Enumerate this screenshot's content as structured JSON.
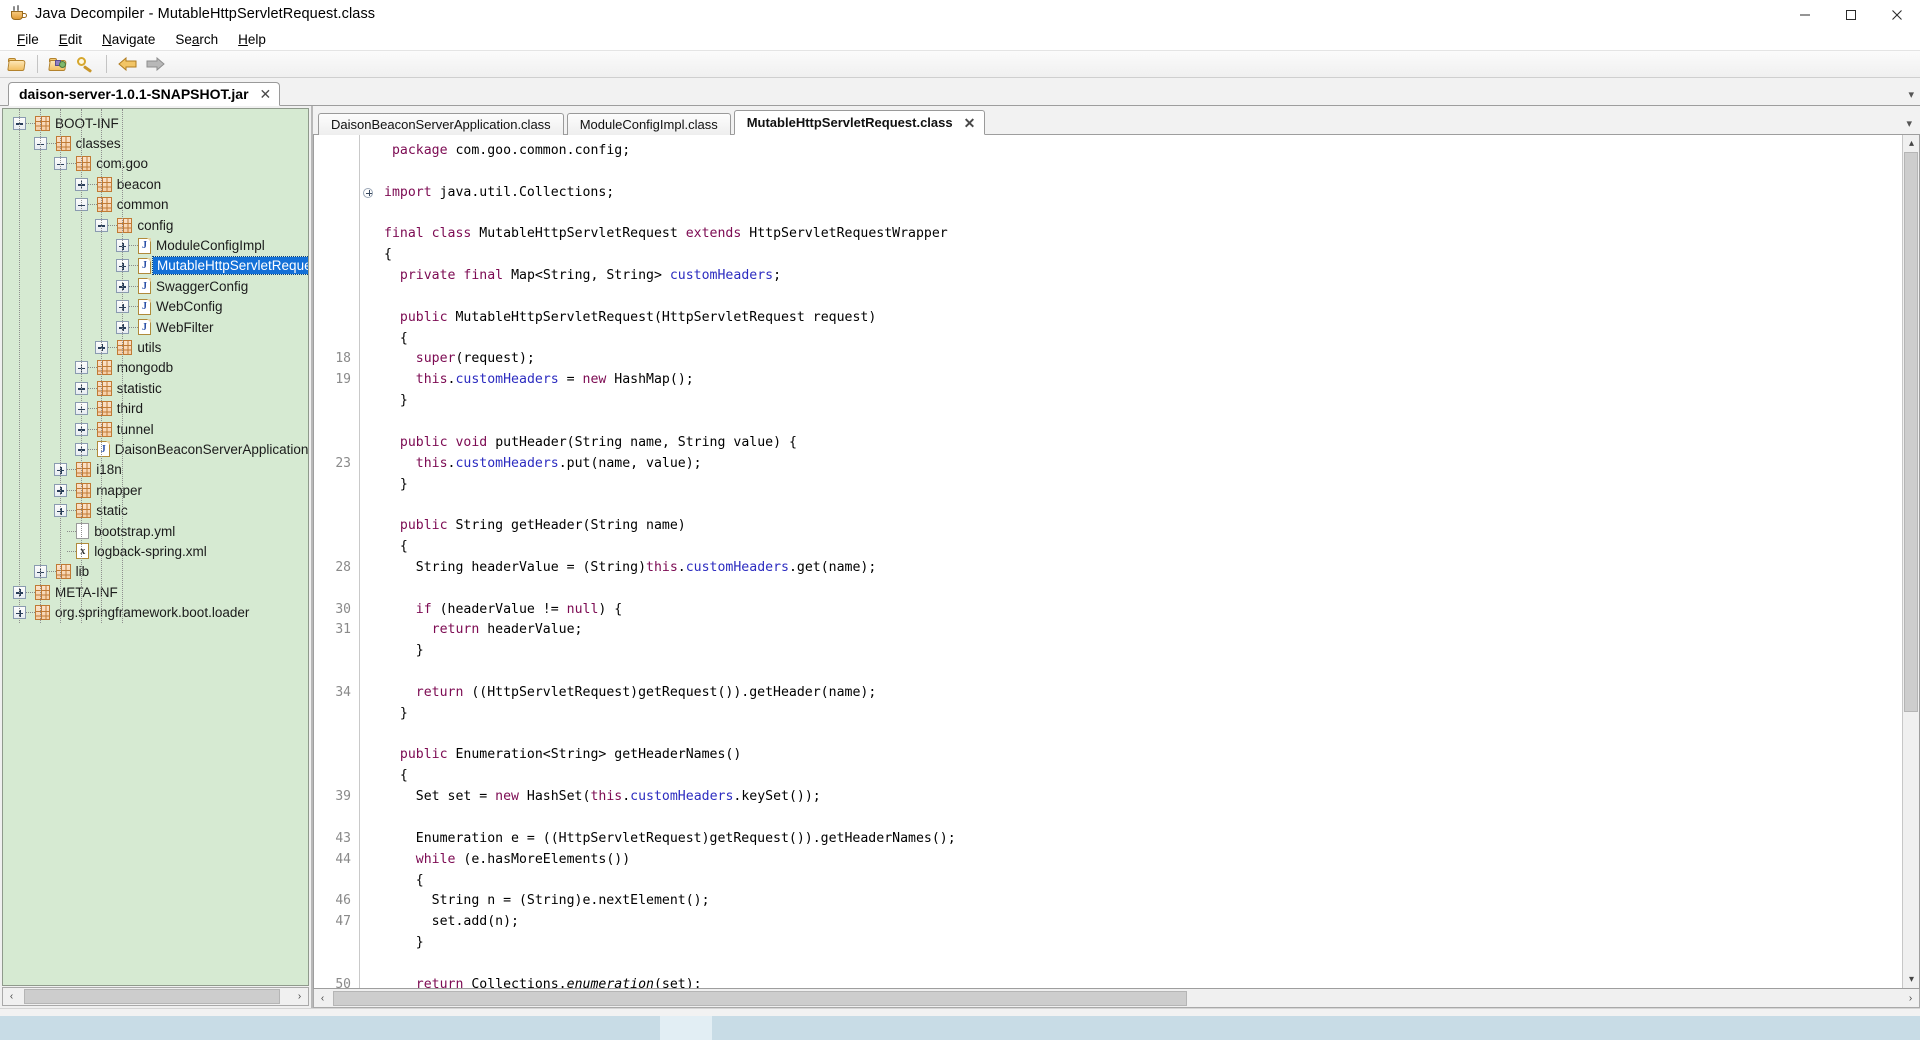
{
  "window": {
    "title": "Java Decompiler - MutableHttpServletRequest.class",
    "app_icon": "java-cup-icon",
    "minimize_label": "─",
    "maximize_label": "❐",
    "close_label": "✕"
  },
  "menubar": {
    "items": [
      {
        "label": "File",
        "mnemonic": "F"
      },
      {
        "label": "Edit",
        "mnemonic": "E"
      },
      {
        "label": "Navigate",
        "mnemonic": "N"
      },
      {
        "label": "Search",
        "mnemonic": "a"
      },
      {
        "label": "Help",
        "mnemonic": "H"
      }
    ]
  },
  "toolbar": {
    "buttons": [
      {
        "name": "open-file-button",
        "icon": "open-folder-icon",
        "tooltip": "Open File"
      },
      {
        "name": "open-type-button",
        "icon": "package-folder-icon",
        "tooltip": "Open Type"
      },
      {
        "name": "search-button",
        "icon": "magnifier-key-icon",
        "tooltip": "Search"
      },
      {
        "name": "back-button",
        "icon": "arrow-left-icon",
        "tooltip": "Back"
      },
      {
        "name": "forward-button",
        "icon": "arrow-right-icon",
        "tooltip": "Forward"
      }
    ]
  },
  "jar_tabs": {
    "active": "daison-server-1.0.1-SNAPSHOT.jar",
    "close_label": "✕",
    "overflow_label": "▾"
  },
  "tree": {
    "background_color": "#d6ead2",
    "selection_color": "#1370d7",
    "nodes": [
      {
        "label": "BOOT-INF",
        "depth": 0,
        "toggle": "minus",
        "icon": "package-icon",
        "selected": false
      },
      {
        "label": "classes",
        "depth": 1,
        "toggle": "minus",
        "icon": "package-icon",
        "selected": false
      },
      {
        "label": "com.goo",
        "depth": 2,
        "toggle": "minus",
        "icon": "package-icon",
        "selected": false
      },
      {
        "label": "beacon",
        "depth": 3,
        "toggle": "plus",
        "icon": "package-icon",
        "selected": false
      },
      {
        "label": "common",
        "depth": 3,
        "toggle": "minus",
        "icon": "package-icon",
        "selected": false
      },
      {
        "label": "config",
        "depth": 4,
        "toggle": "minus",
        "icon": "package-icon",
        "selected": false
      },
      {
        "label": "ModuleConfigImpl",
        "depth": 5,
        "toggle": "plus",
        "icon": "class-icon",
        "selected": false
      },
      {
        "label": "MutableHttpServletRequest",
        "depth": 5,
        "toggle": "plus",
        "icon": "class-icon",
        "selected": true
      },
      {
        "label": "SwaggerConfig",
        "depth": 5,
        "toggle": "plus",
        "icon": "class-icon",
        "selected": false
      },
      {
        "label": "WebConfig",
        "depth": 5,
        "toggle": "plus",
        "icon": "class-icon",
        "selected": false
      },
      {
        "label": "WebFilter",
        "depth": 5,
        "toggle": "plus",
        "icon": "class-icon",
        "selected": false
      },
      {
        "label": "utils",
        "depth": 4,
        "toggle": "plus",
        "icon": "package-icon",
        "selected": false
      },
      {
        "label": "mongodb",
        "depth": 3,
        "toggle": "plus",
        "icon": "package-icon",
        "selected": false
      },
      {
        "label": "statistic",
        "depth": 3,
        "toggle": "plus",
        "icon": "package-icon",
        "selected": false
      },
      {
        "label": "third",
        "depth": 3,
        "toggle": "plus",
        "icon": "package-icon",
        "selected": false
      },
      {
        "label": "tunnel",
        "depth": 3,
        "toggle": "plus",
        "icon": "package-icon",
        "selected": false
      },
      {
        "label": "DaisonBeaconServerApplication",
        "depth": 3,
        "toggle": "plus",
        "icon": "class-icon",
        "selected": false
      },
      {
        "label": "i18n",
        "depth": 2,
        "toggle": "plus",
        "icon": "package-icon",
        "selected": false
      },
      {
        "label": "mapper",
        "depth": 2,
        "toggle": "plus",
        "icon": "package-icon",
        "selected": false
      },
      {
        "label": "static",
        "depth": 2,
        "toggle": "plus",
        "icon": "package-icon",
        "selected": false
      },
      {
        "label": "bootstrap.yml",
        "depth": 2,
        "toggle": "none",
        "icon": "file-icon",
        "selected": false
      },
      {
        "label": "logback-spring.xml",
        "depth": 2,
        "toggle": "none",
        "icon": "xml-file-icon",
        "selected": false
      },
      {
        "label": "lib",
        "depth": 1,
        "toggle": "plus",
        "icon": "package-icon",
        "selected": false
      },
      {
        "label": "META-INF",
        "depth": 0,
        "toggle": "plus",
        "icon": "package-icon",
        "selected": false
      },
      {
        "label": "org.springframework.boot.loader",
        "depth": 0,
        "toggle": "plus",
        "icon": "package-icon",
        "selected": false
      }
    ]
  },
  "editor": {
    "tabs": [
      {
        "label": "DaisonBeaconServerApplication.class",
        "active": false
      },
      {
        "label": "ModuleConfigImpl.class",
        "active": false
      },
      {
        "label": "MutableHttpServletRequest.class",
        "active": true
      }
    ],
    "close_label": "✕",
    "overflow_label": "▾",
    "fold_marker": "+",
    "colors": {
      "keyword": "#7c0a52",
      "field": "#2c2cc0",
      "text": "#000000",
      "line_number": "#8a8a8a",
      "background": "#ffffff"
    },
    "lines": [
      {
        "num": "",
        "indent": 1,
        "tokens": [
          {
            "t": "package",
            "c": "kw"
          },
          {
            "t": " com.goo.common.config;",
            "c": ""
          }
        ]
      },
      {
        "num": "",
        "indent": 0,
        "tokens": []
      },
      {
        "num": "",
        "indent": 0,
        "fold": true,
        "tokens": [
          {
            "t": "import",
            "c": "kw"
          },
          {
            "t": " java.util.Collections;",
            "c": ""
          }
        ]
      },
      {
        "num": "",
        "indent": 0,
        "tokens": []
      },
      {
        "num": "",
        "indent": 0,
        "tokens": [
          {
            "t": "final",
            "c": "kw"
          },
          {
            "t": " ",
            "c": ""
          },
          {
            "t": "class",
            "c": "kw"
          },
          {
            "t": " MutableHttpServletRequest ",
            "c": ""
          },
          {
            "t": "extends",
            "c": "kw"
          },
          {
            "t": " HttpServletRequestWrapper",
            "c": ""
          }
        ]
      },
      {
        "num": "",
        "indent": 0,
        "tokens": [
          {
            "t": "{",
            "c": ""
          }
        ]
      },
      {
        "num": "",
        "indent": 2,
        "tokens": [
          {
            "t": "private",
            "c": "kw"
          },
          {
            "t": " ",
            "c": ""
          },
          {
            "t": "final",
            "c": "kw"
          },
          {
            "t": " Map<String, String> ",
            "c": ""
          },
          {
            "t": "customHeaders",
            "c": "fld"
          },
          {
            "t": ";",
            "c": ""
          }
        ]
      },
      {
        "num": "",
        "indent": 0,
        "tokens": []
      },
      {
        "num": "",
        "indent": 2,
        "tokens": [
          {
            "t": "public",
            "c": "kw"
          },
          {
            "t": " MutableHttpServletRequest(HttpServletRequest request)",
            "c": ""
          }
        ]
      },
      {
        "num": "",
        "indent": 2,
        "tokens": [
          {
            "t": "{",
            "c": ""
          }
        ]
      },
      {
        "num": "18",
        "indent": 4,
        "tokens": [
          {
            "t": "super",
            "c": "kw"
          },
          {
            "t": "(request);",
            "c": ""
          }
        ]
      },
      {
        "num": "19",
        "indent": 4,
        "tokens": [
          {
            "t": "this",
            "c": "kw"
          },
          {
            "t": ".",
            "c": ""
          },
          {
            "t": "customHeaders",
            "c": "fld"
          },
          {
            "t": " = ",
            "c": ""
          },
          {
            "t": "new",
            "c": "kw"
          },
          {
            "t": " HashMap();",
            "c": ""
          }
        ]
      },
      {
        "num": "",
        "indent": 2,
        "tokens": [
          {
            "t": "}",
            "c": ""
          }
        ]
      },
      {
        "num": "",
        "indent": 0,
        "tokens": []
      },
      {
        "num": "",
        "indent": 2,
        "tokens": [
          {
            "t": "public",
            "c": "kw"
          },
          {
            "t": " ",
            "c": ""
          },
          {
            "t": "void",
            "c": "kw"
          },
          {
            "t": " putHeader(String name, String value) {",
            "c": ""
          }
        ]
      },
      {
        "num": "23",
        "indent": 4,
        "tokens": [
          {
            "t": "this",
            "c": "kw"
          },
          {
            "t": ".",
            "c": ""
          },
          {
            "t": "customHeaders",
            "c": "fld"
          },
          {
            "t": ".put(name, value);",
            "c": ""
          }
        ]
      },
      {
        "num": "",
        "indent": 2,
        "tokens": [
          {
            "t": "}",
            "c": ""
          }
        ]
      },
      {
        "num": "",
        "indent": 0,
        "tokens": []
      },
      {
        "num": "",
        "indent": 2,
        "tokens": [
          {
            "t": "public",
            "c": "kw"
          },
          {
            "t": " String getHeader(String name)",
            "c": ""
          }
        ]
      },
      {
        "num": "",
        "indent": 2,
        "tokens": [
          {
            "t": "{",
            "c": ""
          }
        ]
      },
      {
        "num": "28",
        "indent": 4,
        "tokens": [
          {
            "t": "String headerValue = (String)",
            "c": ""
          },
          {
            "t": "this",
            "c": "kw"
          },
          {
            "t": ".",
            "c": ""
          },
          {
            "t": "customHeaders",
            "c": "fld"
          },
          {
            "t": ".get(name);",
            "c": ""
          }
        ]
      },
      {
        "num": "",
        "indent": 0,
        "tokens": []
      },
      {
        "num": "30",
        "indent": 4,
        "tokens": [
          {
            "t": "if",
            "c": "kw"
          },
          {
            "t": " (headerValue != ",
            "c": ""
          },
          {
            "t": "null",
            "c": "kw"
          },
          {
            "t": ") {",
            "c": ""
          }
        ]
      },
      {
        "num": "31",
        "indent": 6,
        "tokens": [
          {
            "t": "return",
            "c": "kw"
          },
          {
            "t": " headerValue;",
            "c": ""
          }
        ]
      },
      {
        "num": "",
        "indent": 4,
        "tokens": [
          {
            "t": "}",
            "c": ""
          }
        ]
      },
      {
        "num": "",
        "indent": 0,
        "tokens": []
      },
      {
        "num": "34",
        "indent": 4,
        "tokens": [
          {
            "t": "return",
            "c": "kw"
          },
          {
            "t": " ((HttpServletRequest)getRequest()).getHeader(name);",
            "c": ""
          }
        ]
      },
      {
        "num": "",
        "indent": 2,
        "tokens": [
          {
            "t": "}",
            "c": ""
          }
        ]
      },
      {
        "num": "",
        "indent": 0,
        "tokens": []
      },
      {
        "num": "",
        "indent": 2,
        "tokens": [
          {
            "t": "public",
            "c": "kw"
          },
          {
            "t": " Enumeration<String> getHeaderNames()",
            "c": ""
          }
        ]
      },
      {
        "num": "",
        "indent": 2,
        "tokens": [
          {
            "t": "{",
            "c": ""
          }
        ]
      },
      {
        "num": "39",
        "indent": 4,
        "tokens": [
          {
            "t": "Set set = ",
            "c": ""
          },
          {
            "t": "new",
            "c": "kw"
          },
          {
            "t": " HashSet(",
            "c": ""
          },
          {
            "t": "this",
            "c": "kw"
          },
          {
            "t": ".",
            "c": ""
          },
          {
            "t": "customHeaders",
            "c": "fld"
          },
          {
            "t": ".keySet());",
            "c": ""
          }
        ]
      },
      {
        "num": "",
        "indent": 0,
        "tokens": []
      },
      {
        "num": "43",
        "indent": 4,
        "tokens": [
          {
            "t": "Enumeration e = ((HttpServletRequest)getRequest()).getHeaderNames();",
            "c": ""
          }
        ]
      },
      {
        "num": "44",
        "indent": 4,
        "tokens": [
          {
            "t": "while",
            "c": "kw"
          },
          {
            "t": " (e.hasMoreElements())",
            "c": ""
          }
        ]
      },
      {
        "num": "",
        "indent": 4,
        "tokens": [
          {
            "t": "{",
            "c": ""
          }
        ]
      },
      {
        "num": "46",
        "indent": 6,
        "tokens": [
          {
            "t": "String n = (String)e.nextElement();",
            "c": ""
          }
        ]
      },
      {
        "num": "47",
        "indent": 6,
        "tokens": [
          {
            "t": "set.add(n);",
            "c": ""
          }
        ]
      },
      {
        "num": "",
        "indent": 4,
        "tokens": [
          {
            "t": "}",
            "c": ""
          }
        ]
      },
      {
        "num": "",
        "indent": 0,
        "tokens": []
      },
      {
        "num": "50",
        "indent": 4,
        "tokens": [
          {
            "t": "return",
            "c": "kw"
          },
          {
            "t": " Collections.",
            "c": ""
          },
          {
            "t": "enumeration",
            "c": "it"
          },
          {
            "t": "(set);",
            "c": ""
          }
        ]
      },
      {
        "num": "",
        "indent": 2,
        "tokens": [
          {
            "t": "}",
            "c": ""
          }
        ]
      }
    ]
  },
  "scrollbars": {
    "left_arrow": "‹",
    "right_arrow": "›",
    "up_arrow": "▴",
    "down_arrow": "▾"
  },
  "taskbar": {
    "clock": ""
  }
}
